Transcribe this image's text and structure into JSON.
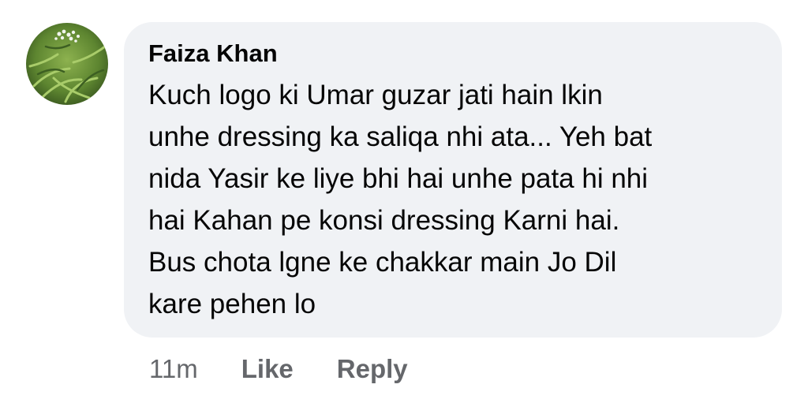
{
  "comment": {
    "avatar": {
      "icon": "profile-photo-plant-avatar",
      "colors": {
        "dark_green": "#3d5f22",
        "mid_green": "#6f9a3a",
        "light_green": "#a9cc6a",
        "flower_white": "#f2f5ee"
      }
    },
    "author": "Faiza Khan",
    "text_lines": [
      "Kuch logo ki Umar guzar jati hain lkin",
      "unhe dressing ka saliqa nhi ata... Yeh bat",
      "nida Yasir ke liye bhi hai unhe pata hi nhi",
      "hai Kahan pe konsi dressing Karni hai.",
      "Bus chota lgne ke chakkar main Jo Dil",
      "kare pehen lo"
    ],
    "timestamp": "11m",
    "actions": {
      "like": "Like",
      "reply": "Reply"
    },
    "colors": {
      "bubble_bg": "#f0f2f5",
      "text": "#050505",
      "meta": "#65676b"
    }
  }
}
